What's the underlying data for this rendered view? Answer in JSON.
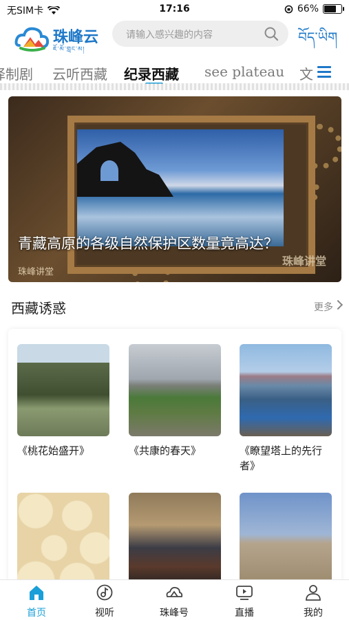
{
  "status_bar": {
    "carrier": "无SIM卡",
    "time": "17:16",
    "battery_percent": "66%",
    "battery_level": 0.66
  },
  "header": {
    "logo_text": "珠峰云",
    "logo_sub": "ཇོ་མོ་གླང་མ།",
    "search_placeholder": "请输入感兴趣的内容",
    "lang_toggle": "བོད་ཡིག"
  },
  "tabs": [
    {
      "label": "译制剧",
      "active": false
    },
    {
      "label": "云听西藏",
      "active": false
    },
    {
      "label": "纪录西藏",
      "active": true
    },
    {
      "label": "see plateau",
      "active": false
    },
    {
      "label": "文",
      "active": false
    }
  ],
  "banner": {
    "title": "青藏高原的各级自然保护区数量竟高达？",
    "source": "珠峰讲堂",
    "watermark": "珠峰讲堂"
  },
  "section": {
    "title": "西藏诱惑",
    "more_label": "更多"
  },
  "cards": [
    {
      "caption": "《桃花始盛开》"
    },
    {
      "caption": "《共康的春天》"
    },
    {
      "caption": "《瞭望塔上的先行者》"
    },
    {
      "caption": ""
    },
    {
      "caption": ""
    },
    {
      "caption": ""
    }
  ],
  "tabbar": [
    {
      "label": "首页",
      "icon": "home-icon",
      "active": true
    },
    {
      "label": "视听",
      "icon": "music-icon",
      "active": false
    },
    {
      "label": "珠峰号",
      "icon": "mountain-icon",
      "active": false
    },
    {
      "label": "直播",
      "icon": "live-icon",
      "active": false
    },
    {
      "label": "我的",
      "icon": "person-icon",
      "active": false
    }
  ],
  "colors": {
    "accent": "#1a9fd8",
    "brand": "#1e78c8"
  }
}
